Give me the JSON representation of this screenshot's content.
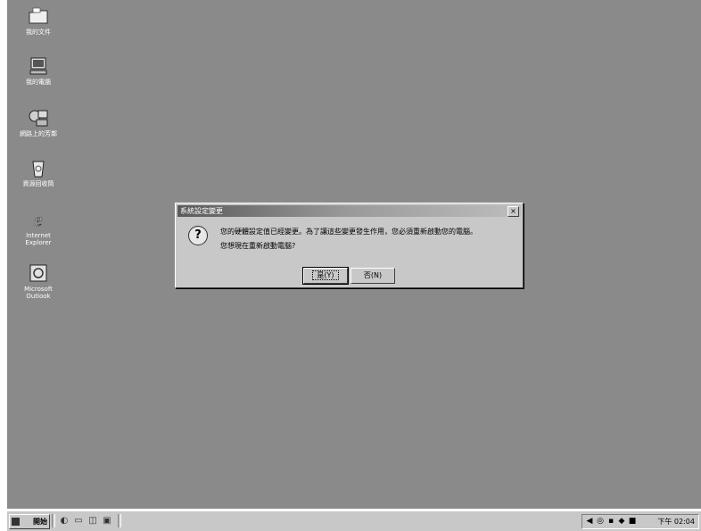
{
  "desktop": {
    "icons": [
      {
        "label": "我的文件",
        "icon": "folder-icon"
      },
      {
        "label": "我的電腦",
        "icon": "computer-icon"
      },
      {
        "label": "網路上的芳鄰",
        "icon": "network-icon"
      },
      {
        "label": "資源回收筒",
        "icon": "recycle-bin-icon"
      },
      {
        "label": "Internet Explorer",
        "icon": "ie-icon"
      },
      {
        "label": "Microsoft Outlook",
        "icon": "outlook-icon"
      }
    ]
  },
  "dialog": {
    "title": "系統設定變更",
    "close_label": "×",
    "icon": "question-icon",
    "message_line1": "您的硬體設定值已經變更。為了讓這些變更發生作用，您必須重新啟動您的電腦。",
    "message_line2": "您想現在重新啟動電腦?",
    "yes_label": "是(Y)",
    "no_label": "否(N)"
  },
  "taskbar": {
    "start_label": "開始",
    "quick_launch": [
      "ie-icon",
      "desktop-icon",
      "outlook-icon",
      "channel-icon"
    ],
    "tray_icons": [
      "volume-icon",
      "network-icon",
      "monitor-icon",
      "ime-icon",
      "keyboard-icon"
    ],
    "clock": "下午 02:04"
  }
}
